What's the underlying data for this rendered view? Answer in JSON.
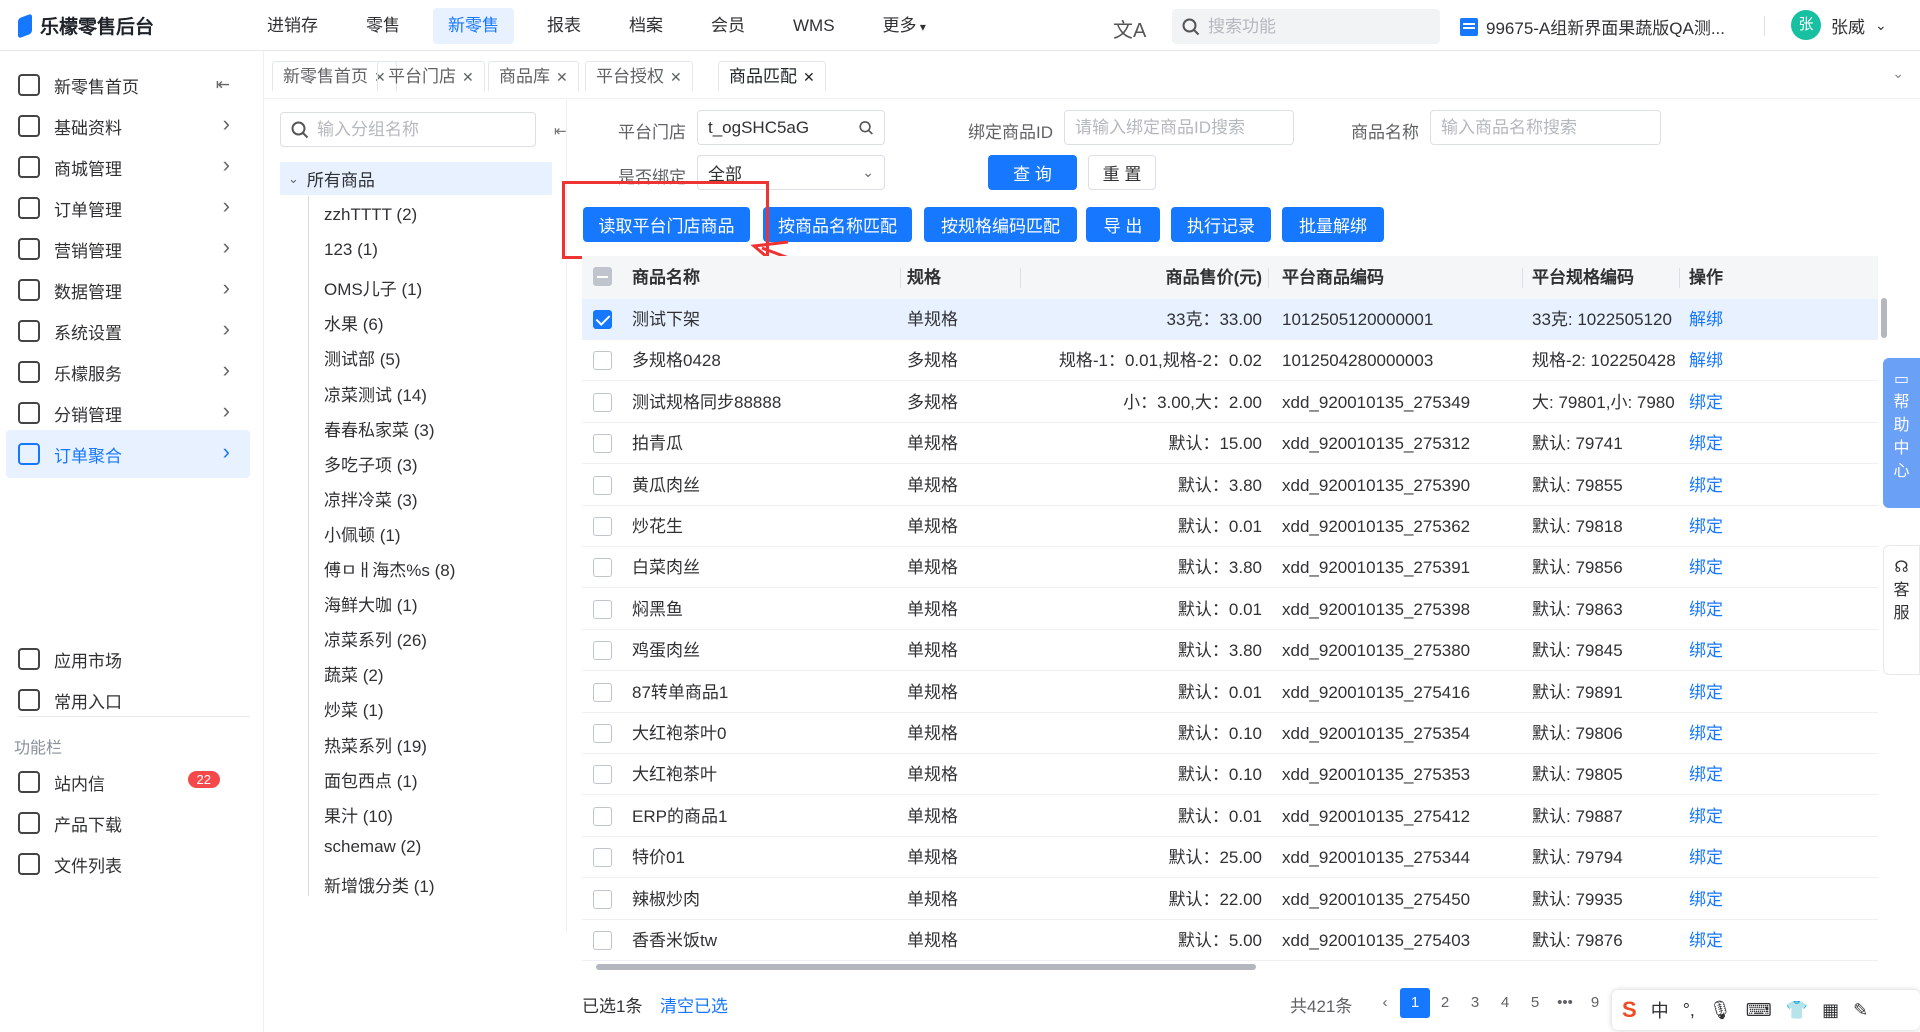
{
  "app": {
    "title": "乐檬零售后台"
  },
  "nav": [
    "进销存",
    "零售",
    "新零售",
    "报表",
    "档案",
    "会员",
    "WMS",
    "更多"
  ],
  "nav_active": 2,
  "search_top": {
    "placeholder": "搜索功能"
  },
  "store": {
    "label": "99675-A组新界面果蔬版QA测..."
  },
  "user": {
    "name": "张威",
    "avatar_text": "张"
  },
  "sidebar": {
    "items": [
      {
        "label": "新零售首页",
        "icon": "home-icon"
      },
      {
        "label": "基础资料",
        "icon": "grid-icon"
      },
      {
        "label": "商城管理",
        "icon": "shop-icon"
      },
      {
        "label": "订单管理",
        "icon": "order-icon"
      },
      {
        "label": "营销管理",
        "icon": "marketing-icon"
      },
      {
        "label": "数据管理",
        "icon": "chart-icon"
      },
      {
        "label": "系统设置",
        "icon": "settings-icon"
      },
      {
        "label": "乐檬服务",
        "icon": "service-icon"
      },
      {
        "label": "分销管理",
        "icon": "distribution-icon"
      },
      {
        "label": "订单聚合",
        "icon": "aggregate-icon"
      }
    ],
    "bottom": [
      {
        "label": "应用市场",
        "icon": "app-market-icon"
      },
      {
        "label": "常用入口",
        "icon": "heart-icon"
      }
    ],
    "section_label": "功能栏",
    "tools": [
      {
        "label": "站内信",
        "icon": "mail-icon",
        "badge": "22"
      },
      {
        "label": "产品下载",
        "icon": "download-icon"
      },
      {
        "label": "文件列表",
        "icon": "file-list-icon"
      }
    ]
  },
  "tabs": [
    "新零售首页",
    "平台门店",
    "商品库",
    "平台授权",
    "商品匹配"
  ],
  "tree": {
    "search_placeholder": "输入分组名称",
    "root": "所有商品",
    "nodes": [
      "zzhTTTT (2)",
      "123 (1)",
      "OMS儿子 (1)",
      "水果 (6)",
      "测试部 (5)",
      "凉菜测试 (14)",
      "春春私家菜 (3)",
      "多吃子项 (3)",
      "凉拌冷菜 (3)",
      "小佩顿 (1)",
      "傅ㅁㅐ海杰%s (8)",
      "海鲜大咖 (1)",
      "凉菜系列 (26)",
      "蔬菜 (2)",
      "炒菜 (1)",
      "热菜系列 (19)",
      "面包西点 (1)",
      "果汁 (10)",
      "schemaw (2)",
      "新增饿分类 (1)"
    ]
  },
  "filters": {
    "store_label": "平台门店",
    "store_value": "t_ogSHC5aG",
    "bind_id_label": "绑定商品ID",
    "bind_id_placeholder": "请输入绑定商品ID搜索",
    "name_label": "商品名称",
    "name_placeholder": "输入商品名称搜索",
    "bound_label": "是否绑定",
    "bound_value": "全部",
    "query": "查 询",
    "reset": "重 置"
  },
  "actions": [
    "读取平台门店商品",
    "按商品名称匹配",
    "按规格编码匹配",
    "导 出",
    "执行记录",
    "批量解绑"
  ],
  "table": {
    "headers": [
      "商品名称",
      "规格",
      "商品售价(元)",
      "平台商品编码",
      "平台规格编码",
      "操作"
    ],
    "rows": [
      {
        "name": "测试下架",
        "spec": "单规格",
        "price": "33克：33.00",
        "code": "1012505120000001",
        "spec_code": "33克: 1022505120",
        "op": "解绑",
        "checked": true
      },
      {
        "name": "多规格0428",
        "spec": "多规格",
        "price": "规格-1：0.01,规格-2：0.02",
        "code": "1012504280000003",
        "spec_code": "规格-2: 102250428",
        "op": "解绑"
      },
      {
        "name": "测试规格同步88888",
        "spec": "多规格",
        "price": "小：3.00,大：2.00",
        "code": "xdd_920010135_275349",
        "spec_code": "大: 79801,小: 7980",
        "op": "绑定"
      },
      {
        "name": "拍青瓜",
        "spec": "单规格",
        "price": "默认：15.00",
        "code": "xdd_920010135_275312",
        "spec_code": "默认: 79741",
        "op": "绑定"
      },
      {
        "name": "黄瓜肉丝",
        "spec": "单规格",
        "price": "默认：3.80",
        "code": "xdd_920010135_275390",
        "spec_code": "默认: 79855",
        "op": "绑定"
      },
      {
        "name": "炒花生",
        "spec": "单规格",
        "price": "默认：0.01",
        "code": "xdd_920010135_275362",
        "spec_code": "默认: 79818",
        "op": "绑定"
      },
      {
        "name": "白菜肉丝",
        "spec": "单规格",
        "price": "默认：3.80",
        "code": "xdd_920010135_275391",
        "spec_code": "默认: 79856",
        "op": "绑定"
      },
      {
        "name": "焖黑鱼",
        "spec": "单规格",
        "price": "默认：0.01",
        "code": "xdd_920010135_275398",
        "spec_code": "默认: 79863",
        "op": "绑定"
      },
      {
        "name": "鸡蛋肉丝",
        "spec": "单规格",
        "price": "默认：3.80",
        "code": "xdd_920010135_275380",
        "spec_code": "默认: 79845",
        "op": "绑定"
      },
      {
        "name": "87转单商品1",
        "spec": "单规格",
        "price": "默认：0.01",
        "code": "xdd_920010135_275416",
        "spec_code": "默认: 79891",
        "op": "绑定"
      },
      {
        "name": "大红袍茶叶0",
        "spec": "单规格",
        "price": "默认：0.10",
        "code": "xdd_920010135_275354",
        "spec_code": "默认: 79806",
        "op": "绑定"
      },
      {
        "name": "大红袍茶叶",
        "spec": "单规格",
        "price": "默认：0.10",
        "code": "xdd_920010135_275353",
        "spec_code": "默认: 79805",
        "op": "绑定"
      },
      {
        "name": "ERP的商品1",
        "spec": "单规格",
        "price": "默认：0.01",
        "code": "xdd_920010135_275412",
        "spec_code": "默认: 79887",
        "op": "绑定"
      },
      {
        "name": "特价01",
        "spec": "单规格",
        "price": "默认：25.00",
        "code": "xdd_920010135_275344",
        "spec_code": "默认: 79794",
        "op": "绑定"
      },
      {
        "name": "辣椒炒肉",
        "spec": "单规格",
        "price": "默认：22.00",
        "code": "xdd_920010135_275450",
        "spec_code": "默认: 79935",
        "op": "绑定"
      },
      {
        "name": "香香米饭tw",
        "spec": "单规格",
        "price": "默认：5.00",
        "code": "xdd_920010135_275403",
        "spec_code": "默认: 79876",
        "op": "绑定"
      }
    ]
  },
  "footer": {
    "selected": "已选1条",
    "clear": "清空已选",
    "total": "共421条"
  },
  "pager": [
    "1",
    "2",
    "3",
    "4",
    "5",
    "•••",
    "9"
  ],
  "pager_active": 0,
  "float": {
    "help": "帮助中心",
    "service": "客服"
  },
  "ime": {
    "s": "S",
    "zh": "中",
    "punct": "°,"
  },
  "colors": {
    "accent": "#1677ff",
    "highlight_box": "#e33333",
    "badge": "#f5484b"
  }
}
